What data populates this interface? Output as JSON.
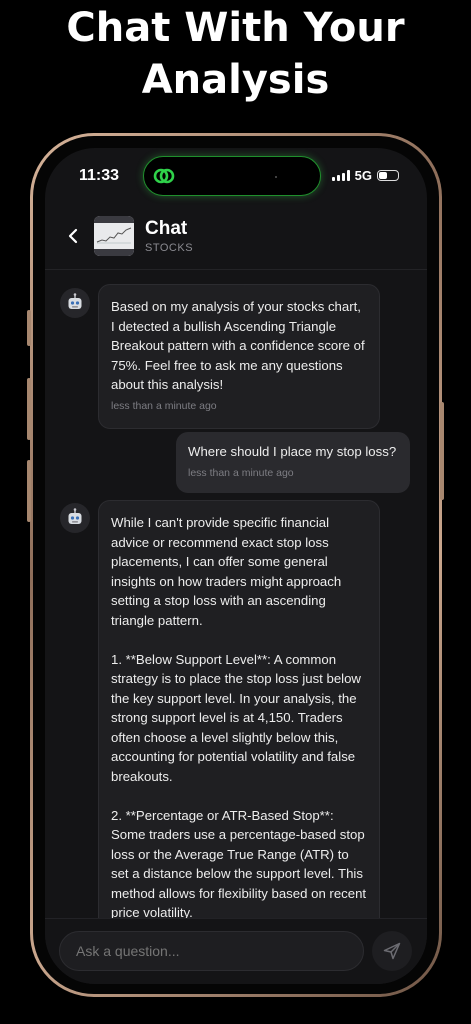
{
  "headline": {
    "line1": "Chat With Your",
    "line2": "Analysis"
  },
  "status_bar": {
    "time": "11:33",
    "network": "5G"
  },
  "header": {
    "title": "Chat",
    "subtitle": "STOCKS"
  },
  "messages": [
    {
      "role": "assistant",
      "text": "Based on my analysis of your stocks chart, I detected a bullish Ascending Triangle Breakout pattern with a confidence score of 75%. Feel free to ask me any questions about this analysis!",
      "time": "less than a minute ago"
    },
    {
      "role": "user",
      "text": "Where should I place my stop loss?",
      "time": "less than a minute ago"
    },
    {
      "role": "assistant",
      "paragraphs": [
        "While I can't provide specific financial advice or recommend exact stop loss placements, I can offer some general insights on how traders might approach setting a stop loss with an ascending triangle pattern.",
        "1. **Below Support Level**: A common strategy is to place the stop loss just below the key support level. In your analysis, the strong support level is at 4,150. Traders often choose a level slightly below this, accounting for potential volatility and false breakouts.",
        "2. **Percentage or ATR-Based Stop**: Some traders use a percentage-based stop loss or the Average True Range (ATR) to set a distance below the support level. This method allows for flexibility based on recent price volatility."
      ]
    }
  ],
  "composer": {
    "placeholder": "Ask a question..."
  },
  "colors": {
    "accent_green": "#2fd14a",
    "background": "#141416",
    "bubble_bot": "#1f1f22",
    "bubble_user": "#2a2a2e"
  },
  "icons": {
    "back": "chevron-left-icon",
    "send": "send-icon",
    "bot": "robot-icon",
    "app_logo": "link-rings-icon"
  }
}
